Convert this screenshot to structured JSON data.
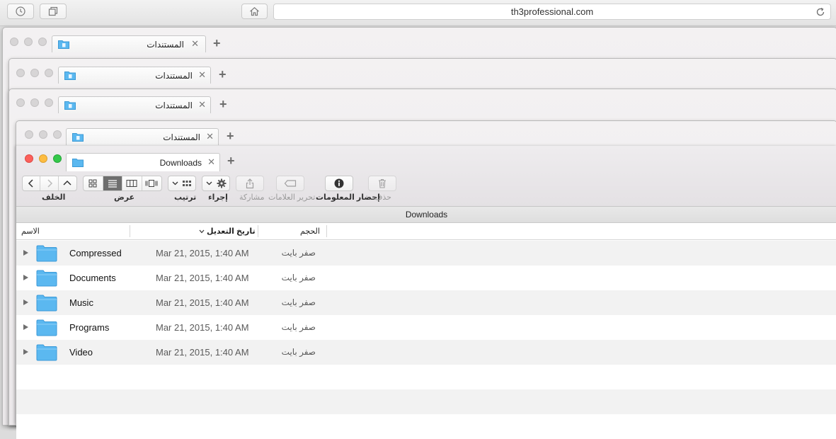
{
  "safari": {
    "url": "th3professional.com",
    "icons": [
      "history-icon",
      "tabs-overview-icon",
      "home-icon",
      "reload-icon"
    ]
  },
  "bg_windows": [
    {
      "tab_title": "المستندات"
    },
    {
      "tab_title": "المستندات"
    },
    {
      "tab_title": "المستندات"
    },
    {
      "tab_title": "المستندات"
    }
  ],
  "finder": {
    "tab_title": "Downloads",
    "path_title": "Downloads",
    "toolbar": {
      "back_label": "الخلف",
      "view_label": "عرض",
      "arrange_label": "ترتيب",
      "action_label": "إجراء",
      "share_label": "مشاركة",
      "edit_tags_label": "تحرير العلامات",
      "get_info_label": "إحضار المعلومات",
      "delete_label": "حذف"
    },
    "columns": {
      "name": "الاسم",
      "date_modified": "تاريخ التعديل",
      "size": "الحجم"
    },
    "rows": [
      {
        "name": "Compressed",
        "date": "Mar 21, 2015, 1:40 AM",
        "size": "صفر بايت"
      },
      {
        "name": "Documents",
        "date": "Mar 21, 2015, 1:40 AM",
        "size": "صفر بايت"
      },
      {
        "name": "Music",
        "date": "Mar 21, 2015, 1:40 AM",
        "size": "صفر بايت"
      },
      {
        "name": "Programs",
        "date": "Mar 21, 2015, 1:40 AM",
        "size": "صفر بايت"
      },
      {
        "name": "Video",
        "date": "Mar 21, 2015, 1:40 AM",
        "size": "صفر بايت"
      }
    ]
  },
  "colors": {
    "folder_blue": "#5bb8f0",
    "close": "#fc605b",
    "minimize": "#fdbc40",
    "zoom": "#34c84a"
  }
}
